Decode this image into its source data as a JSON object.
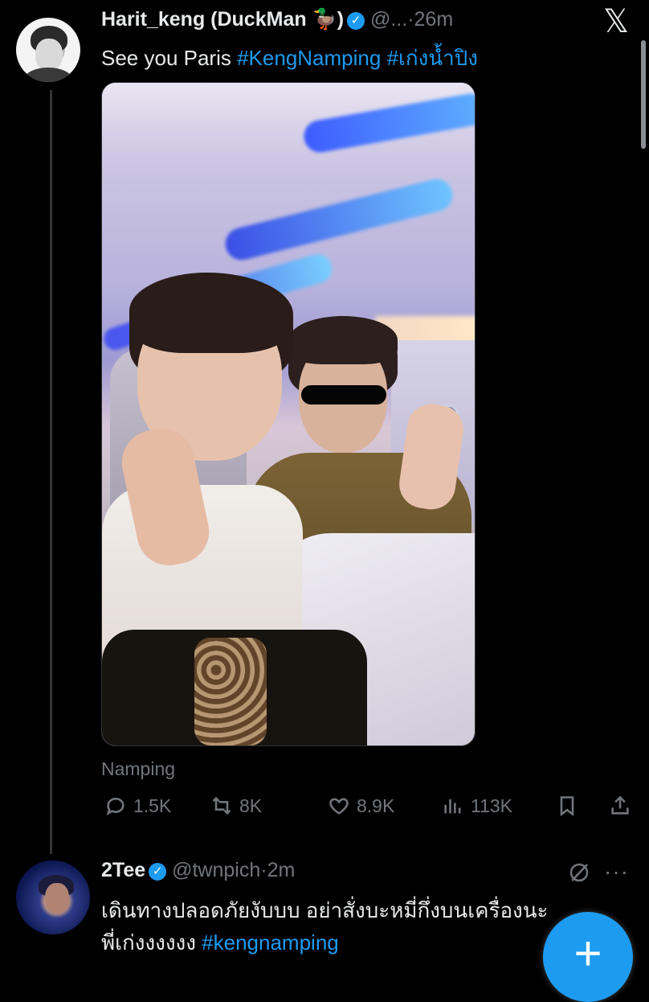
{
  "tweet1": {
    "display_name": "Harit_keng (DuckMan 🦆)",
    "handle": "@...",
    "time": "·26m",
    "text_plain": "See you Paris ",
    "hashtag1": "#KengNamping",
    "hashtag2": "#เก่งน้ำปิง",
    "image_caption": "Namping",
    "actions": {
      "replies": "1.5K",
      "reposts": "8K",
      "likes": "8.9K",
      "views": "113K"
    }
  },
  "tweet2": {
    "display_name": "2Tee",
    "handle": "@twnpich",
    "time": "·2m",
    "more": "···",
    "line1": "เดินทางปลอดภัยงับบบ อย่าสั่งบะหมี่กึ่งบนเครื่องนะ",
    "line2_plain": "พี่เก่งงงงงง ",
    "hashtag": "#kengnamping"
  },
  "app": {
    "logo": "𝕏",
    "verified_mark": "✓",
    "fab_label": "+"
  },
  "icons": {
    "reply": "reply-icon",
    "repost": "repost-icon",
    "like": "heart-icon",
    "views": "views-icon",
    "bookmark": "bookmark-icon",
    "share": "share-icon",
    "grok": "grok-icon",
    "x_logo": "x-logo-icon"
  },
  "colors": {
    "background": "#000000",
    "text": "#e7e9ea",
    "muted": "#71767b",
    "accent": "#1d9bf0"
  }
}
